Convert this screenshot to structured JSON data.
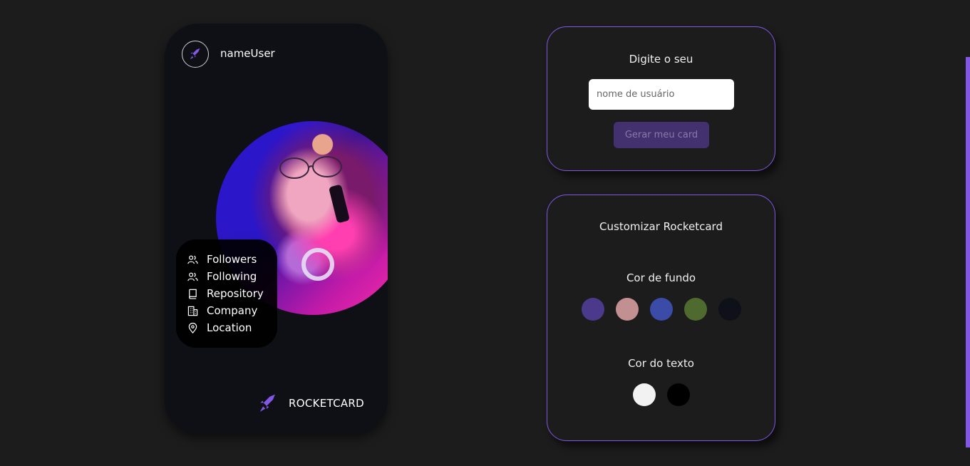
{
  "card": {
    "username": "nameUser",
    "stats": [
      {
        "icon": "users-icon",
        "label": "Followers"
      },
      {
        "icon": "users-icon",
        "label": "Following"
      },
      {
        "icon": "book-icon",
        "label": "Repository"
      },
      {
        "icon": "building-icon",
        "label": "Company"
      },
      {
        "icon": "map-pin-icon",
        "label": "Location"
      }
    ],
    "brand": "ROCKETCARD"
  },
  "search": {
    "title": "Digite o seu",
    "placeholder": "nome de usuário",
    "value": "",
    "button_label": "Gerar meu card"
  },
  "customize": {
    "title": "Customizar Rocketcard",
    "background_label": "Cor de fundo",
    "background_colors": [
      "#4b3a8c",
      "#c29090",
      "#3b4ba8",
      "#4f6a2e",
      "#0f111a"
    ],
    "text_label": "Cor do texto",
    "text_colors": [
      "#f2f2f2",
      "#000000"
    ]
  },
  "colors": {
    "accent": "#8257e5",
    "page_background": "#1c1c1c",
    "card_background": "#0e1015"
  }
}
